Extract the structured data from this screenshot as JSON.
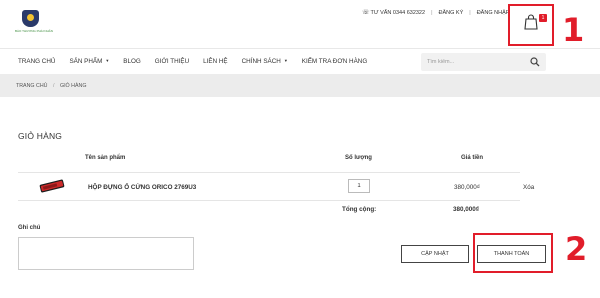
{
  "header": {
    "logo_text": "BẢO THƯƠNG PHẢI NHÂN",
    "phone_label": "TƯ VẤN 0344 632322",
    "register_label": "ĐĂNG KÝ",
    "login_label": "ĐĂNG NHẬP",
    "cart_count": "1"
  },
  "nav": {
    "items": [
      {
        "label": "TRANG CHỦ"
      },
      {
        "label": "SẢN PHẨM"
      },
      {
        "label": "BLOG"
      },
      {
        "label": "GIỚI THIỆU"
      },
      {
        "label": "LIÊN HỆ"
      },
      {
        "label": "CHÍNH SÁCH"
      },
      {
        "label": "KIỂM TRA ĐƠN HÀNG"
      }
    ],
    "search_placeholder": "Tìm kiếm..."
  },
  "breadcrumb": {
    "home": "TRANG CHỦ",
    "current": "GIỎ HÀNG"
  },
  "cart": {
    "title": "GIỎ HÀNG",
    "columns": {
      "name": "Tên sản phẩm",
      "quantity": "Số lượng",
      "price": "Giá tiền"
    },
    "items": [
      {
        "name": "HỘP ĐỰNG Ổ CỨNG ORICO 2769U3",
        "quantity": "1",
        "price": "380,000₫",
        "remove": "Xóa"
      }
    ],
    "total_label": "Tổng cộng:",
    "total_value": "380,000₫",
    "note_label": "Ghi chú",
    "update_button": "CẬP NHẬT",
    "checkout_button": "THANH TOÁN"
  },
  "annotations": {
    "callout_1": "1",
    "callout_2": "2",
    "highlight_color": "#e11d2a"
  }
}
